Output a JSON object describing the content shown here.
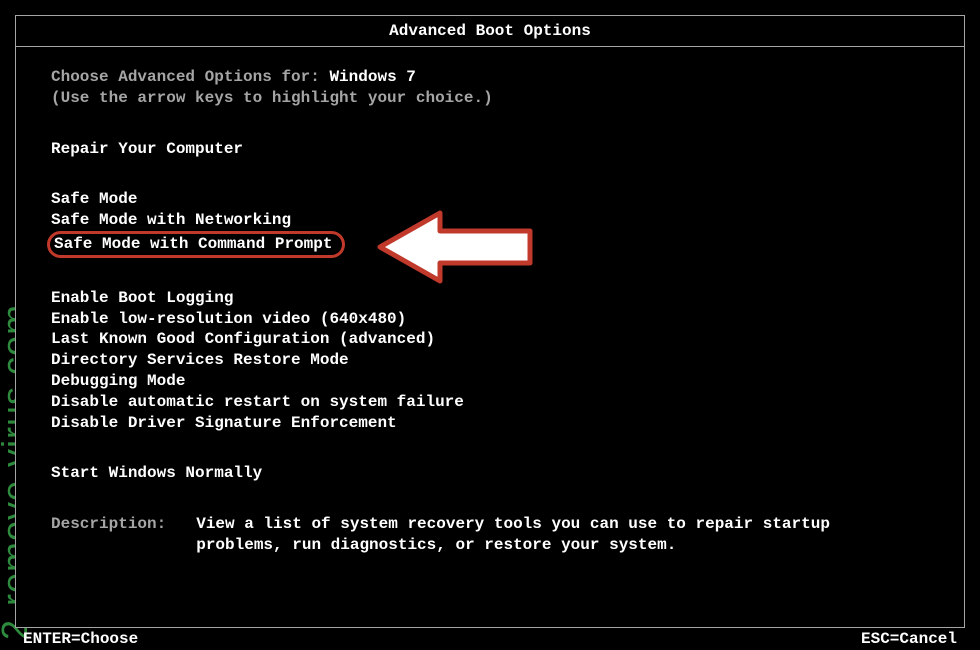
{
  "title": "Advanced Boot Options",
  "intro": {
    "prefix": "Choose Advanced Options for: ",
    "os_name": "Windows 7",
    "hint": "(Use the arrow keys to highlight your choice.)"
  },
  "sections": {
    "repair": "Repair Your Computer",
    "safemode": [
      "Safe Mode",
      "Safe Mode with Networking",
      "Safe Mode with Command Prompt"
    ],
    "other": [
      "Enable Boot Logging",
      "Enable low-resolution video (640x480)",
      "Last Known Good Configuration (advanced)",
      "Directory Services Restore Mode",
      "Debugging Mode",
      "Disable automatic restart on system failure",
      "Disable Driver Signature Enforcement"
    ],
    "normal": "Start Windows Normally"
  },
  "description": {
    "label": "Description:",
    "text": "View a list of system recovery tools you can use to repair startup problems, run diagnostics, or restore your system."
  },
  "footer": {
    "enter": "ENTER=Choose",
    "esc": "ESC=Cancel"
  },
  "watermark": "2-remove-virus.com",
  "highlighted_index": 2
}
